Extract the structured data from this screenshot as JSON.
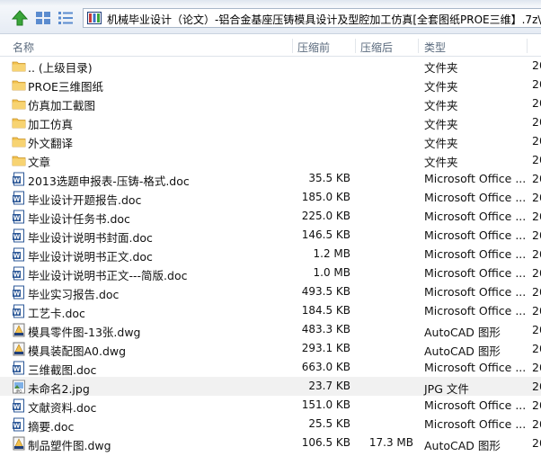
{
  "address": {
    "path": "机械毕业设计（论文）-铝合金基座压铸模具设计及型腔加工仿真[全套图纸PROE三维】.7z\\机"
  },
  "columns": {
    "name": "名称",
    "size": "压缩前",
    "packed": "压缩后",
    "type": "类型"
  },
  "files": [
    {
      "name": ".. (上级目录)",
      "size": "",
      "packed": "",
      "type": "文件夹",
      "date": "20",
      "icon": "folder-icon"
    },
    {
      "name": "PROE三维图纸",
      "size": "",
      "packed": "",
      "type": "文件夹",
      "date": "20",
      "icon": "folder-icon"
    },
    {
      "name": "仿真加工截图",
      "size": "",
      "packed": "",
      "type": "文件夹",
      "date": "20",
      "icon": "folder-icon"
    },
    {
      "name": "加工仿真",
      "size": "",
      "packed": "",
      "type": "文件夹",
      "date": "20",
      "icon": "folder-icon"
    },
    {
      "name": "外文翻译",
      "size": "",
      "packed": "",
      "type": "文件夹",
      "date": "20",
      "icon": "folder-icon"
    },
    {
      "name": "文章",
      "size": "",
      "packed": "",
      "type": "文件夹",
      "date": "20",
      "icon": "folder-icon"
    },
    {
      "name": "2013选题申报表-压铸-格式.doc",
      "size": "35.5 KB",
      "packed": "",
      "type": "Microsoft Office ...",
      "date": "20",
      "icon": "word-doc-icon"
    },
    {
      "name": "毕业设计开题报告.doc",
      "size": "185.0 KB",
      "packed": "",
      "type": "Microsoft Office ...",
      "date": "20",
      "icon": "word-doc-icon"
    },
    {
      "name": "毕业设计任务书.doc",
      "size": "225.0 KB",
      "packed": "",
      "type": "Microsoft Office ...",
      "date": "20",
      "icon": "word-doc-icon"
    },
    {
      "name": "毕业设计说明书封面.doc",
      "size": "146.5 KB",
      "packed": "",
      "type": "Microsoft Office ...",
      "date": "20",
      "icon": "word-doc-icon"
    },
    {
      "name": "毕业设计说明书正文.doc",
      "size": "1.2 MB",
      "packed": "",
      "type": "Microsoft Office ...",
      "date": "20",
      "icon": "word-doc-icon"
    },
    {
      "name": "毕业设计说明书正文---简版.doc",
      "size": "1.0 MB",
      "packed": "",
      "type": "Microsoft Office ...",
      "date": "20",
      "icon": "word-doc-icon"
    },
    {
      "name": "毕业实习报告.doc",
      "size": "493.5 KB",
      "packed": "",
      "type": "Microsoft Office ...",
      "date": "20",
      "icon": "word-doc-icon"
    },
    {
      "name": "工艺卡.doc",
      "size": "184.5 KB",
      "packed": "",
      "type": "Microsoft Office ...",
      "date": "20",
      "icon": "word-doc-icon"
    },
    {
      "name": "模具零件图-13张.dwg",
      "size": "483.3 KB",
      "packed": "",
      "type": "AutoCAD 图形",
      "date": "20",
      "icon": "autocad-dwg-icon"
    },
    {
      "name": "模具装配图A0.dwg",
      "size": "293.1 KB",
      "packed": "",
      "type": "AutoCAD 图形",
      "date": "20",
      "icon": "autocad-dwg-icon"
    },
    {
      "name": "三维截图.doc",
      "size": "663.0 KB",
      "packed": "",
      "type": "Microsoft Office ...",
      "date": "20",
      "icon": "word-doc-icon"
    },
    {
      "name": "未命名2.jpg",
      "size": "23.7 KB",
      "packed": "",
      "type": "JPG 文件",
      "date": "20",
      "icon": "jpg-image-icon",
      "selected": true
    },
    {
      "name": "文献资料.doc",
      "size": "151.0 KB",
      "packed": "",
      "type": "Microsoft Office ...",
      "date": "20",
      "icon": "word-doc-icon"
    },
    {
      "name": "摘要.doc",
      "size": "25.5 KB",
      "packed": "",
      "type": "Microsoft Office ...",
      "date": "20",
      "icon": "word-doc-icon"
    },
    {
      "name": "制品塑件图.dwg",
      "size": "106.5 KB",
      "packed": "17.3 MB",
      "type": "AutoCAD 图形",
      "date": "20",
      "icon": "autocad-dwg-icon"
    }
  ],
  "colors": {
    "folder": "#f2c14e",
    "word_blue": "#2b5797",
    "selection": "#f1f1f1"
  }
}
